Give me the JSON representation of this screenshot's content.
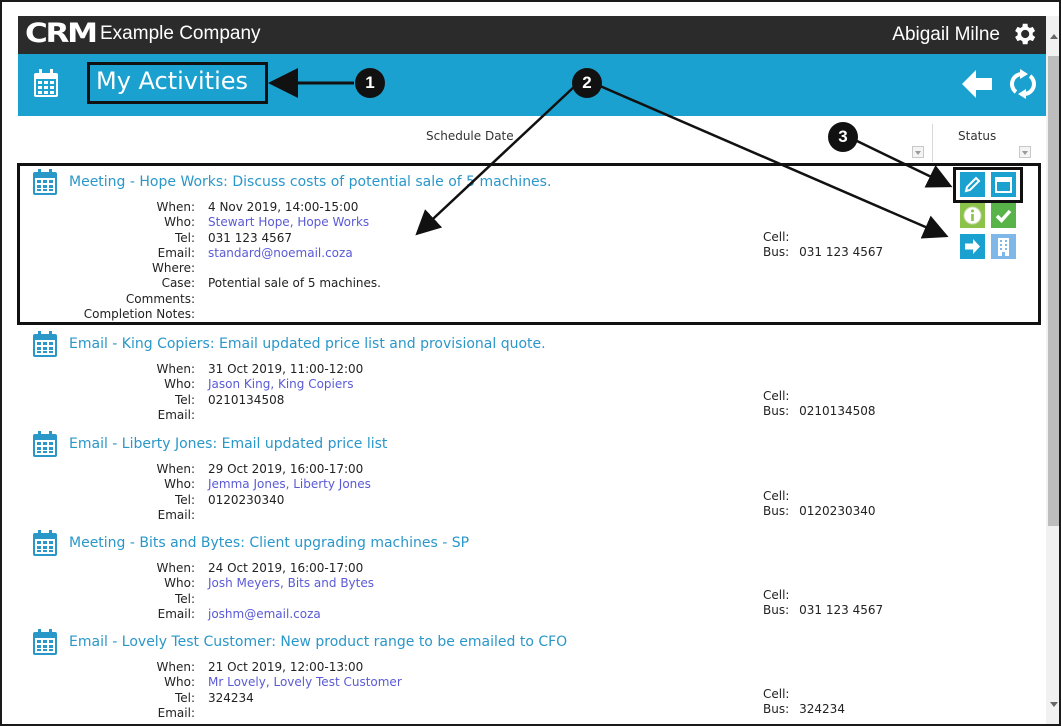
{
  "app": {
    "logo_text": "CRM",
    "company": "Example Company",
    "user": "Abigail Milne"
  },
  "header": {
    "title": "My Activities"
  },
  "annotations": [
    "1",
    "2",
    "3"
  ],
  "columns": {
    "schedule_date": "Schedule Date",
    "status": "Status"
  },
  "labels": {
    "when": "When:",
    "who": "Who:",
    "tel": "Tel:",
    "email": "Email:",
    "where": "Where:",
    "case": "Case:",
    "comments": "Comments:",
    "completion_notes": "Completion Notes:",
    "cell": "Cell:",
    "bus": "Bus:"
  },
  "activities": [
    {
      "title": "Meeting - Hope Works: Discuss costs of potential sale of 5 machines.",
      "when": "4 Nov 2019, 14:00-15:00",
      "who": "Stewart Hope, Hope Works",
      "tel": "031 123 4567",
      "email": "standard@noemail.coza",
      "where": "",
      "case": "Potential sale of 5 machines.",
      "comments": "",
      "completion_notes": "",
      "cell": "",
      "bus": "031 123 4567"
    },
    {
      "title": "Email - King Copiers: Email updated price list and provisional quote.",
      "when": "31 Oct 2019, 11:00-12:00",
      "who": "Jason King, King Copiers",
      "tel": "0210134508",
      "email": "",
      "cell": "",
      "bus": "0210134508"
    },
    {
      "title": "Email - Liberty Jones: Email updated price list",
      "when": "29 Oct 2019, 16:00-17:00",
      "who": "Jemma Jones, Liberty Jones",
      "tel": "0120230340",
      "email": "",
      "cell": "",
      "bus": "0120230340"
    },
    {
      "title": "Meeting - Bits and Bytes: Client upgrading machines - SP",
      "when": "24 Oct 2019, 16:00-17:00",
      "who": "Josh Meyers, Bits and Bytes",
      "tel": "",
      "email": "joshm@email.coza",
      "cell": "",
      "bus": "031 123 4567"
    },
    {
      "title": "Email - Lovely Test Customer: New product range to be emailed to CFO",
      "when": "21 Oct 2019, 12:00-13:00",
      "who": "Mr Lovely, Lovely Test Customer",
      "tel": "324234",
      "email": "",
      "cell": "",
      "bus": "324234"
    }
  ],
  "actions": {
    "icons": [
      "edit-icon",
      "calendar-icon",
      "info-icon",
      "check-icon",
      "forward-icon",
      "building-icon"
    ]
  },
  "colors": {
    "header_blue": "#1ba1cf",
    "topbar": "#2b2b2b",
    "link": "#2a97c9",
    "green": "#58b449"
  }
}
